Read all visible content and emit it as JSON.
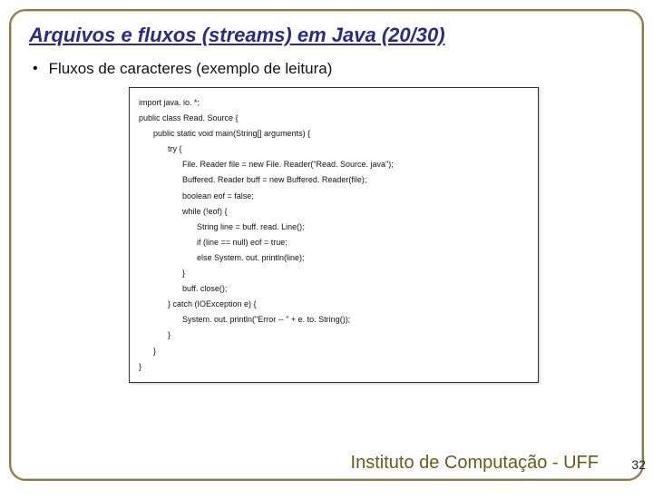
{
  "title": "Arquivos e fluxos (streams) em Java (20/30)",
  "bullet": "Fluxos de caracteres (exemplo de leitura)",
  "code": {
    "l1": "import java. io. *;",
    "l2": "public class  Read. Source {",
    "l3": "public static void main(String[] arguments) {",
    "l4": "try {",
    "l5": "File. Reader file = new   File. Reader(\"Read. Source. java\");",
    "l6": "Buffered. Reader buff = new    Buffered. Reader(file);",
    "l7": "boolean eof = false;",
    "l8": "while (!eof) {",
    "l9": "String line = buff. read. Line();",
    "l10": "if (line == null)   eof = true;",
    "l11": "else    System. out. println(line);",
    "l12": "}",
    "l13": "buff. close();",
    "l14": "} catch (IOException e) {",
    "l15": "System. out. println(\"Error -- \" + e. to. String());",
    "l16": "}",
    "l17": "}",
    "l18": "}"
  },
  "footer": "Instituto de Computação - UFF",
  "page": "32"
}
